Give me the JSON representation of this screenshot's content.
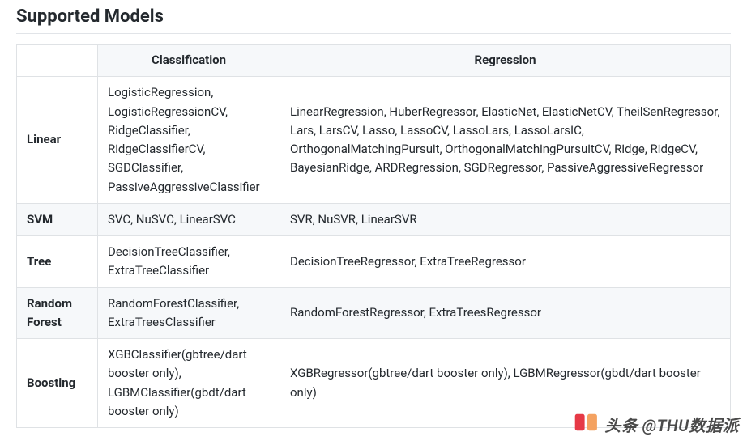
{
  "heading": "Supported Models",
  "columns": {
    "blank": "",
    "classification": "Classification",
    "regression": "Regression"
  },
  "rows": [
    {
      "label": "Linear",
      "classification": "LogisticRegression, LogisticRegressionCV, RidgeClassifier, RidgeClassifierCV, SGDClassifier, PassiveAggressiveClassifier",
      "regression": "LinearRegression, HuberRegressor, ElasticNet, ElasticNetCV, TheilSenRegressor, Lars, LarsCV, Lasso, LassoCV, LassoLars, LassoLarsIC, OrthogonalMatchingPursuit, OrthogonalMatchingPursuitCV, Ridge, RidgeCV, BayesianRidge, ARDRegression, SGDRegressor, PassiveAggressiveRegressor"
    },
    {
      "label": "SVM",
      "classification": "SVC, NuSVC, LinearSVC",
      "regression": "SVR, NuSVR, LinearSVR"
    },
    {
      "label": "Tree",
      "classification": "DecisionTreeClassifier, ExtraTreeClassifier",
      "regression": "DecisionTreeRegressor, ExtraTreeRegressor"
    },
    {
      "label": "Random Forest",
      "classification": "RandomForestClassifier, ExtraTreesClassifier",
      "regression": "RandomForestRegressor, ExtraTreesRegressor"
    },
    {
      "label": "Boosting",
      "classification": "XGBClassifier(gbtree/dart booster only), LGBMClassifier(gbdt/dart booster only)",
      "regression": "XGBRegressor(gbtree/dart booster only), LGBMRegressor(gbdt/dart booster only)"
    }
  ],
  "watermark": "头条 @THU数据派"
}
